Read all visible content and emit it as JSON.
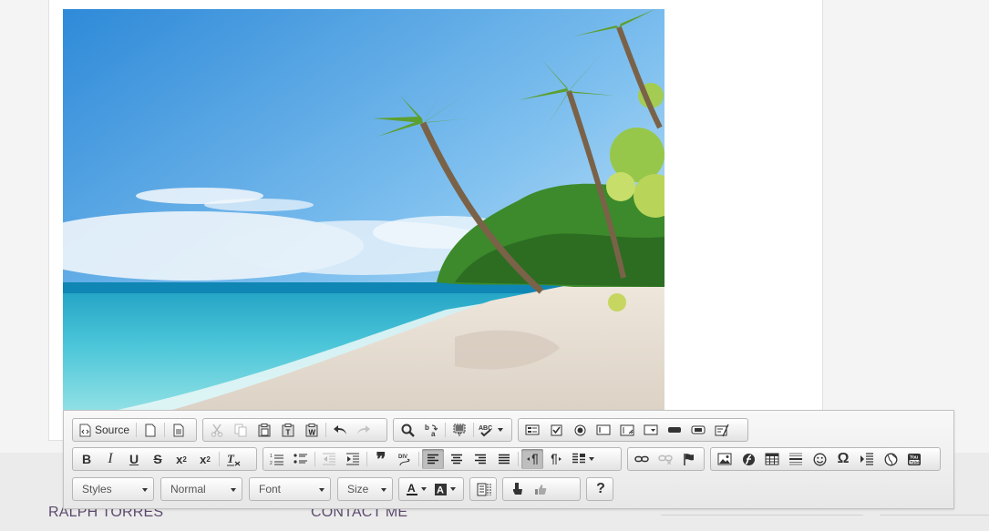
{
  "footer": {
    "name_link": "RALPH TORRES",
    "contact_link": "CONTACT ME"
  },
  "toolbar": {
    "source_label": "Source",
    "styles_label": "Styles",
    "format_label": "Normal",
    "font_label": "Font",
    "size_label": "Size",
    "help_label": "?"
  }
}
